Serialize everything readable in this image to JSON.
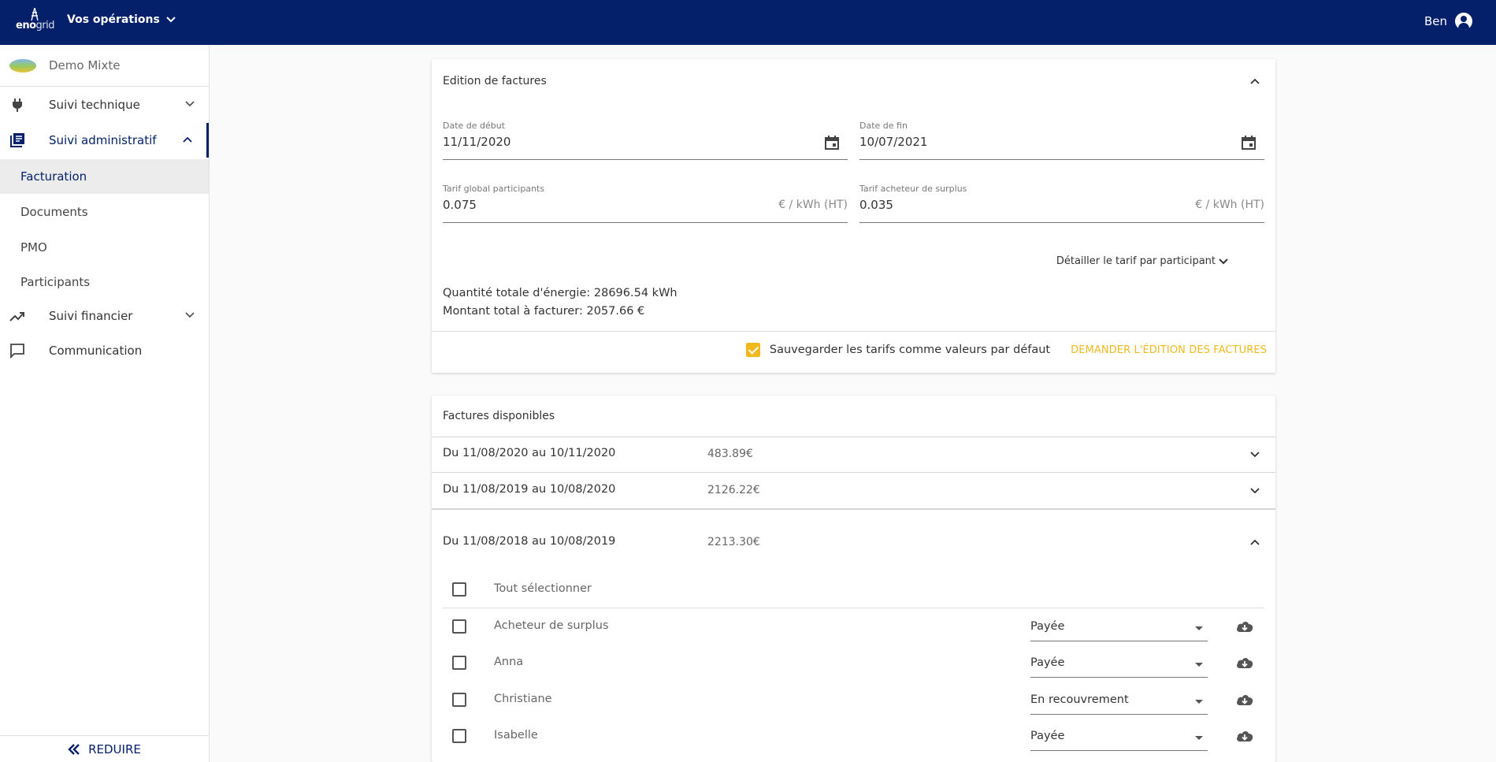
{
  "topbar": {
    "logo_main": "eno",
    "logo_sub": "grid",
    "operations_label": "Vos opérations",
    "user_name": "Ben"
  },
  "sidebar": {
    "org_name": "Demo Mixte",
    "items": [
      {
        "label": "Suivi technique",
        "icon": "plug-icon"
      },
      {
        "label": "Suivi administratif",
        "icon": "document-list-icon"
      },
      {
        "label": "Suivi financier",
        "icon": "trending-up-icon"
      },
      {
        "label": "Communication",
        "icon": "chat-icon"
      }
    ],
    "subitems": [
      "Facturation",
      "Documents",
      "PMO",
      "Participants"
    ],
    "footer_label": "REDUIRE"
  },
  "edition": {
    "title": "Edition de factures",
    "start_date_label": "Date de début",
    "start_date_value": "11/11/2020",
    "end_date_label": "Date de fin",
    "end_date_value": "10/07/2021",
    "tarif_global_label": "Tarif global participants",
    "tarif_global_value": "0.075",
    "tarif_global_suffix": "€ / kWh (HT)",
    "tarif_surplus_label": "Tarif acheteur de surplus",
    "tarif_surplus_value": "0.035",
    "tarif_surplus_suffix": "€ / kWh (HT)",
    "detail_link": "Détailler le tarif par participant",
    "total_energy": "Quantité totale d'énergie: 28696.54 kWh",
    "total_amount": "Montant total à facturer: 2057.66 €",
    "save_default_label": "Sauvegarder les tarifs comme valeurs par défaut",
    "save_default_checked": true,
    "action_label": "DEMANDER L'ÉDITION DES FACTURES"
  },
  "invoices": {
    "title": "Factures disponibles",
    "rows": [
      {
        "period": "Du 11/08/2020 au 10/11/2020",
        "amount": "483.89€",
        "expanded": false
      },
      {
        "period": "Du 11/08/2019 au 10/08/2020",
        "amount": "2126.22€",
        "expanded": false
      },
      {
        "period": "Du 11/08/2018 au 10/08/2019",
        "amount": "2213.30€",
        "expanded": true
      }
    ],
    "select_all_label": "Tout sélectionner",
    "participants": [
      {
        "name": "Acheteur de surplus",
        "status": "Payée"
      },
      {
        "name": "Anna",
        "status": "Payée"
      },
      {
        "name": "Christiane",
        "status": "En recouvrement"
      },
      {
        "name": "Isabelle",
        "status": "Payée"
      }
    ]
  },
  "colors": {
    "primary": "#04206b",
    "accent": "#f2b91d",
    "background": "#fafafa"
  }
}
